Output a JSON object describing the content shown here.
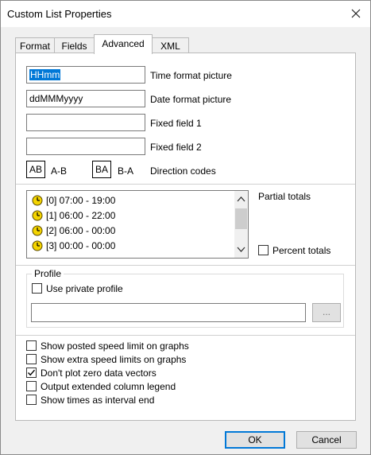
{
  "window": {
    "title": "Custom List Properties"
  },
  "tabs": [
    {
      "label": "Format"
    },
    {
      "label": "Fields"
    },
    {
      "label": "Advanced"
    },
    {
      "label": "XML"
    }
  ],
  "advanced": {
    "time_format": {
      "value": "HHmm",
      "label": "Time format picture"
    },
    "date_format": {
      "value": "ddMMMyyyy",
      "label": "Date format picture"
    },
    "fixed_field_1": {
      "value": "",
      "label": "Fixed field 1"
    },
    "fixed_field_2": {
      "value": "",
      "label": "Fixed field 2"
    },
    "direction": {
      "code_ab": "AB",
      "label_ab": "A-B",
      "code_ba": "BA",
      "label_ba": "B-A",
      "label": "Direction codes"
    },
    "partial_totals": {
      "label": "Partial totals",
      "items": [
        "[0] 07:00 - 19:00",
        "[1] 06:00 - 22:00",
        "[2] 06:00 - 00:00",
        "[3] 00:00 - 00:00"
      ]
    },
    "percent_totals": {
      "label": "Percent totals",
      "checked": false
    },
    "profile": {
      "group_label": "Profile",
      "use_private_label": "Use private profile",
      "use_private_checked": false,
      "path_value": "",
      "browse_label": "..."
    },
    "options": [
      {
        "label": "Show posted speed limit on graphs",
        "checked": false
      },
      {
        "label": "Show extra speed limits on graphs",
        "checked": false
      },
      {
        "label": "Don't plot zero data vectors",
        "checked": true
      },
      {
        "label": "Output extended column legend",
        "checked": false
      },
      {
        "label": "Show times as interval end",
        "checked": false
      }
    ]
  },
  "buttons": {
    "ok": "OK",
    "cancel": "Cancel"
  },
  "colors": {
    "selection": "#0078d7",
    "clock_icon": "#f4d400"
  }
}
